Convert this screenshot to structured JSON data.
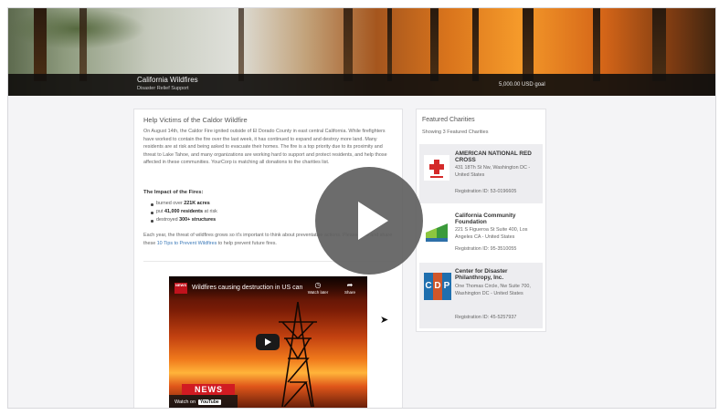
{
  "hero": {
    "title": "California Wildfires",
    "subtitle": "Disaster Relief Support",
    "goal": "5,000.00 USD goal"
  },
  "main": {
    "title": "Help Victims of the Caldor Wildfire",
    "body": "On August 14th, the Caldor Fire ignited outside of El Dorado County in east central California. While firefighters have worked to contain the fire over the last week, it has continued to expand and destroy more land. Many residents are at risk and being asked to evacuate their homes. The fire is a top priority due to its proximity and threat to Lake Tahoe, and many organizations are working hard to support and protect residents, and help those affected in these communities. YourCorp is matching all donations to the charities list.",
    "impact_title": "The Impact of the Fires:",
    "impact_items": [
      {
        "prefix": "burned over ",
        "bold": "221K acres",
        "suffix": ""
      },
      {
        "prefix": "put ",
        "bold": "41,000 residents",
        "suffix": " at risk"
      },
      {
        "prefix": "destroyed ",
        "bold": "300+ structures",
        "suffix": ""
      }
    ],
    "closing_before": "Each year, the threat of wildfires grows so it's important to think about preventative actions. Please view and share these ",
    "closing_link": "10 Tips to Prevent Wildfires",
    "closing_after": " to help prevent future fires."
  },
  "video": {
    "channel_badge": "NEWS",
    "title": "Wildfires causing destruction in US can",
    "watch_later": "Watch later",
    "share": "Share",
    "watch_on": "Watch on",
    "platform": "YouTube",
    "banner": "NEWS"
  },
  "featured": {
    "title": "Featured Charities",
    "count_text": "Showing 3 Featured Charities",
    "charities": [
      {
        "name": "AMERICAN NATIONAL RED CROSS",
        "address": "431 18Th St Nw, Washington DC - United States",
        "registration": "Registration ID: 53-0196605",
        "logo": "red-cross-logo"
      },
      {
        "name": "California Community Foundation",
        "address": "221 S Figueroa St Suite 400, Los Angeles CA - United States",
        "registration": "Registration ID: 95-3510055",
        "logo": "ccf-logo"
      },
      {
        "name": "Center for Disaster Philanthropy, Inc.",
        "address": "One Thomas Circle, Nw Suite 700, Washington DC - United States",
        "registration": "Registration ID: 45-5257937",
        "logo": "cdp-logo",
        "logo_letters": [
          "C",
          "D",
          "P"
        ]
      }
    ]
  },
  "colors": {
    "link": "#3b79b8",
    "red_cross": "#d42a2a",
    "news_red": "#d11b22",
    "cdp": [
      "#1f6fae",
      "#d0562a",
      "#1f6fae"
    ]
  },
  "overlay": {
    "icon": "play-icon"
  },
  "pointer": {
    "icon": "cursor-arrow-icon"
  }
}
